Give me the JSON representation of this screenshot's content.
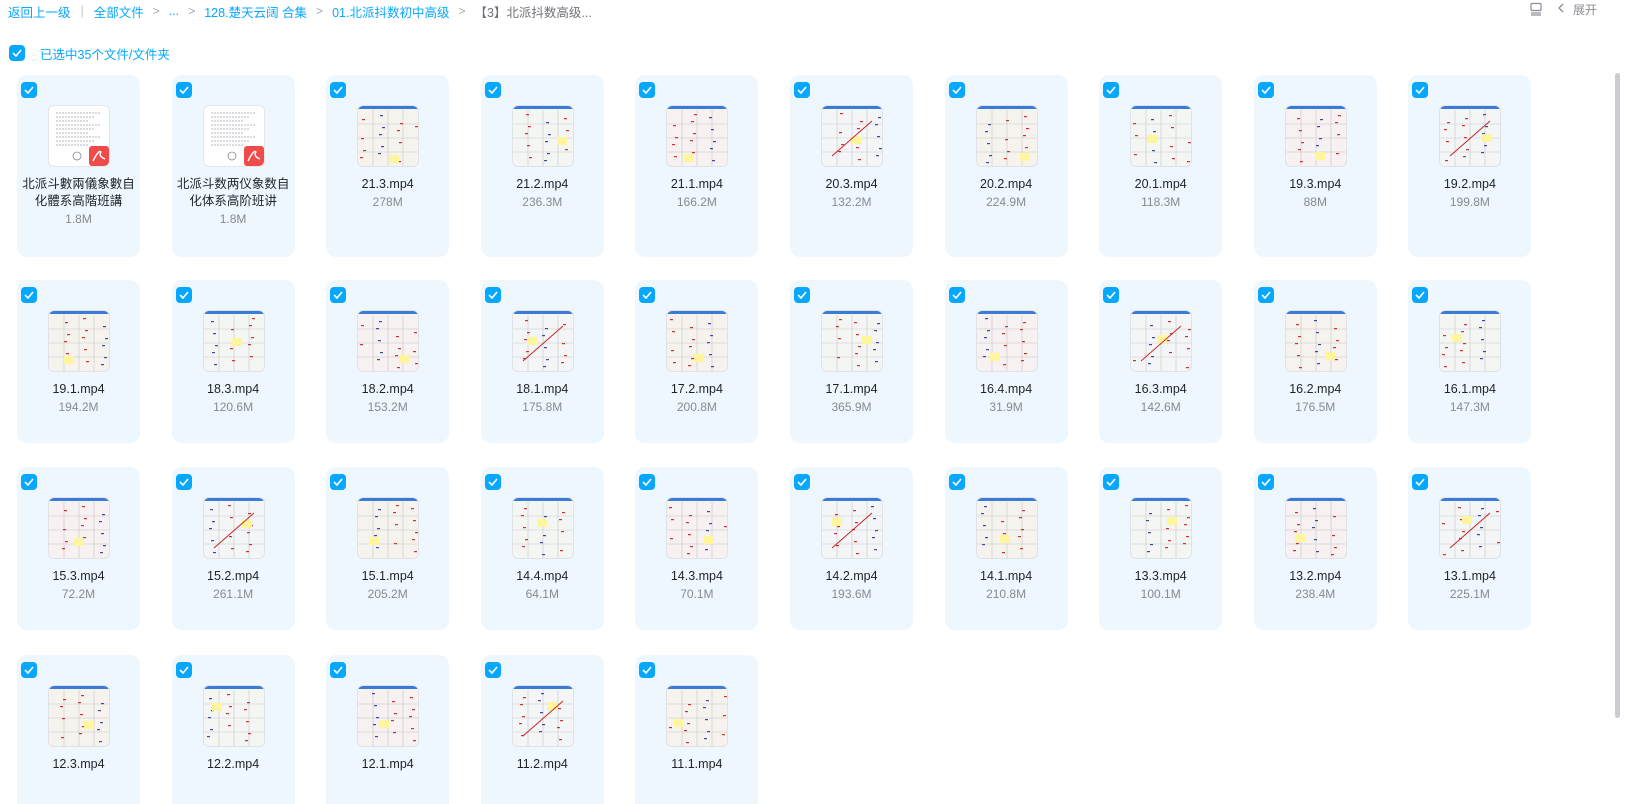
{
  "breadcrumb": {
    "back": "返回上一级",
    "all_files": "全部文件",
    "ellipsis": "...",
    "level1": "128.楚天云阔 合集",
    "level2": "01.北派抖数初中高级",
    "current": "【3】北派抖数高级..."
  },
  "toolbar": {
    "collapse_label": "展开"
  },
  "selection": {
    "label": "已选中35个文件/文件夹"
  },
  "files": [
    {
      "name": "北派斗數兩儀象數自化體系高階班講",
      "size": "1.8M",
      "kind": "pdf"
    },
    {
      "name": "北派斗数两仪象数自化体系高阶班讲",
      "size": "1.8M",
      "kind": "pdf"
    },
    {
      "name": "21.3.mp4",
      "size": "278M",
      "kind": "video"
    },
    {
      "name": "21.2.mp4",
      "size": "236.3M",
      "kind": "video"
    },
    {
      "name": "21.1.mp4",
      "size": "166.2M",
      "kind": "video"
    },
    {
      "name": "20.3.mp4",
      "size": "132.2M",
      "kind": "video"
    },
    {
      "name": "20.2.mp4",
      "size": "224.9M",
      "kind": "video"
    },
    {
      "name": "20.1.mp4",
      "size": "118.3M",
      "kind": "video"
    },
    {
      "name": "19.3.mp4",
      "size": "88M",
      "kind": "video"
    },
    {
      "name": "19.2.mp4",
      "size": "199.8M",
      "kind": "video"
    },
    {
      "name": "19.1.mp4",
      "size": "194.2M",
      "kind": "video"
    },
    {
      "name": "18.3.mp4",
      "size": "120.6M",
      "kind": "video"
    },
    {
      "name": "18.2.mp4",
      "size": "153.2M",
      "kind": "video"
    },
    {
      "name": "18.1.mp4",
      "size": "175.8M",
      "kind": "video"
    },
    {
      "name": "17.2.mp4",
      "size": "200.8M",
      "kind": "video"
    },
    {
      "name": "17.1.mp4",
      "size": "365.9M",
      "kind": "video"
    },
    {
      "name": "16.4.mp4",
      "size": "31.9M",
      "kind": "video"
    },
    {
      "name": "16.3.mp4",
      "size": "142.6M",
      "kind": "video"
    },
    {
      "name": "16.2.mp4",
      "size": "176.5M",
      "kind": "video"
    },
    {
      "name": "16.1.mp4",
      "size": "147.3M",
      "kind": "video"
    },
    {
      "name": "15.3.mp4",
      "size": "72.2M",
      "kind": "video"
    },
    {
      "name": "15.2.mp4",
      "size": "261.1M",
      "kind": "video"
    },
    {
      "name": "15.1.mp4",
      "size": "205.2M",
      "kind": "video"
    },
    {
      "name": "14.4.mp4",
      "size": "64.1M",
      "kind": "video"
    },
    {
      "name": "14.3.mp4",
      "size": "70.1M",
      "kind": "video"
    },
    {
      "name": "14.2.mp4",
      "size": "193.6M",
      "kind": "video"
    },
    {
      "name": "14.1.mp4",
      "size": "210.8M",
      "kind": "video"
    },
    {
      "name": "13.3.mp4",
      "size": "100.1M",
      "kind": "video"
    },
    {
      "name": "13.2.mp4",
      "size": "238.4M",
      "kind": "video"
    },
    {
      "name": "13.1.mp4",
      "size": "225.1M",
      "kind": "video"
    },
    {
      "name": "12.3.mp4",
      "size": "",
      "kind": "video"
    },
    {
      "name": "12.2.mp4",
      "size": "",
      "kind": "video"
    },
    {
      "name": "12.1.mp4",
      "size": "",
      "kind": "video"
    },
    {
      "name": "11.2.mp4",
      "size": "",
      "kind": "video"
    },
    {
      "name": "11.1.mp4",
      "size": "",
      "kind": "video"
    }
  ],
  "colors": {
    "accent": "#06a7ff",
    "card_bg": "#eef7fe",
    "pdf_red": "#f04b4b"
  }
}
